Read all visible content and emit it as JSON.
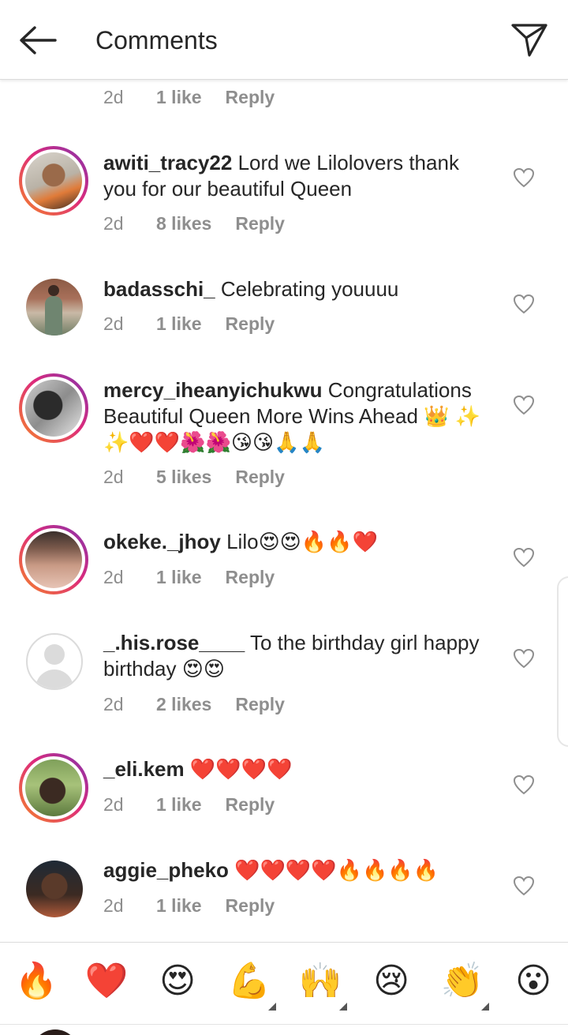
{
  "header": {
    "title": "Comments",
    "back_icon": "arrow-left-icon",
    "send_icon": "paper-plane-icon"
  },
  "previous_meta": {
    "time": "2d",
    "likes": "1 like",
    "reply": "Reply"
  },
  "comments": [
    {
      "username": "awiti_tracy22",
      "text": "Lord we Lilolovers thank you for our beautiful Queen",
      "time": "2d",
      "likes": "8 likes",
      "reply": "Reply",
      "story_ring": true
    },
    {
      "username": "badasschi_",
      "text": "Celebrating youuuu",
      "time": "2d",
      "likes": "1 like",
      "reply": "Reply",
      "story_ring": false
    },
    {
      "username": "mercy_iheanyichukwu",
      "text": "Congratulations Beautiful Queen More Wins Ahead 👑 ✨ ✨❤️❤️🌺🌺😘😘🙏🙏",
      "time": "2d",
      "likes": "5 likes",
      "reply": "Reply",
      "story_ring": true
    },
    {
      "username": "okeke._jhoy",
      "text": "Lilo😍😍🔥🔥❤️",
      "time": "2d",
      "likes": "1 like",
      "reply": "Reply",
      "story_ring": true
    },
    {
      "username": "_.his.rose____",
      "text": "To the birthday girl happy birthday 😍😍",
      "time": "2d",
      "likes": "2 likes",
      "reply": "Reply",
      "story_ring": false
    },
    {
      "username": "_eli.kem",
      "text": "❤️❤️❤️❤️",
      "time": "2d",
      "likes": "1 like",
      "reply": "Reply",
      "story_ring": true
    },
    {
      "username": "aggie_pheko",
      "text": "❤️❤️❤️❤️🔥🔥🔥🔥",
      "time": "2d",
      "likes": "1 like",
      "reply": "Reply",
      "story_ring": false
    }
  ],
  "emoji_bar": [
    "🔥",
    "❤️",
    "😍",
    "💪",
    "🙌",
    "😢",
    "👏",
    "😮"
  ],
  "colors": {
    "text": "#262626",
    "muted": "#8e8e8e",
    "heart_outline": "#8e8e8e",
    "ring_start": "#f58529",
    "ring_end": "#8134af"
  }
}
